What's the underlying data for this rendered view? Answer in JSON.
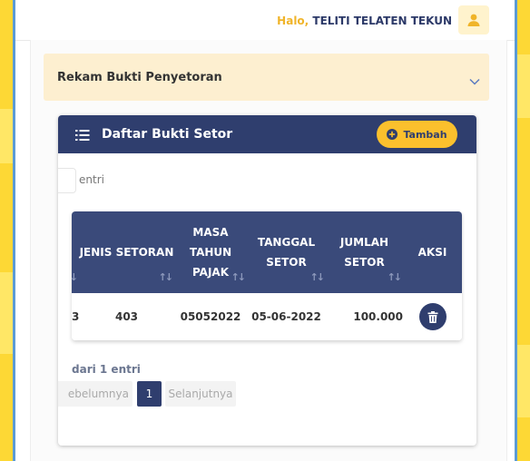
{
  "topbar": {
    "greeting": "Halo,",
    "user_name": "TELITI TELATEN TEKUN",
    "avatar_icon": "user-icon"
  },
  "accordion": {
    "title": "Rekam Bukti Penyetoran",
    "icon": "chevron-down-icon"
  },
  "card": {
    "title": "Daftar Bukti Setor",
    "title_icon": "list-icon",
    "add_button_label": "Tambah",
    "add_button_icon": "plus-circle-icon"
  },
  "table": {
    "length_suffix": "entri",
    "columns": [
      "JENIS SETORAN",
      "MASA TAHUN PAJAK",
      "TANGGAL SETOR",
      "JUMLAH SETOR",
      "AKSI"
    ],
    "rows": [
      {
        "partial_first": "3",
        "jenis_setoran": "403",
        "masa_tahun_pajak": "05052022",
        "tanggal_setor": "05-06-2022",
        "jumlah_setor": "100.000",
        "action_icon": "trash-icon"
      }
    ],
    "info": "dari 1 entri",
    "pagination": {
      "prev_label": "ebelumnya",
      "current_page": "1",
      "next_label": "Selanjutnya"
    }
  },
  "colors": {
    "navy": "#2f3e6e",
    "accent_yellow": "#fbc02d",
    "background_yellow": "#fdd835",
    "accordion_bg": "#fdefd0"
  }
}
